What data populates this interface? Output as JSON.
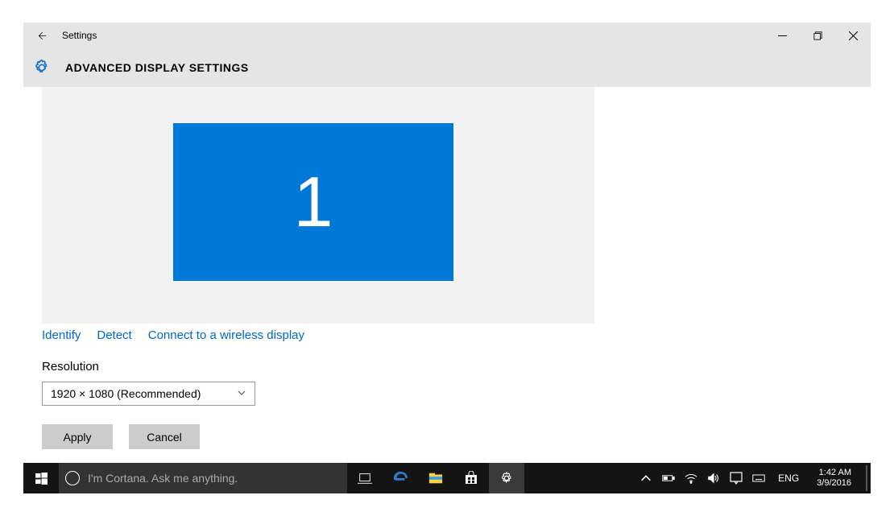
{
  "titlebar": {
    "appname": "Settings"
  },
  "header": {
    "title": "ADVANCED DISPLAY SETTINGS"
  },
  "monitor": {
    "number": "1"
  },
  "links": {
    "identify": "Identify",
    "detect": "Detect",
    "wireless": "Connect to a wireless display"
  },
  "resolution": {
    "label": "Resolution",
    "selected": "1920 × 1080 (Recommended)"
  },
  "buttons": {
    "apply": "Apply",
    "cancel": "Cancel"
  },
  "taskbar": {
    "search_placeholder": "I'm Cortana. Ask me anything.",
    "lang": "ENG",
    "time": "1:42 AM",
    "date": "3/9/2016"
  }
}
